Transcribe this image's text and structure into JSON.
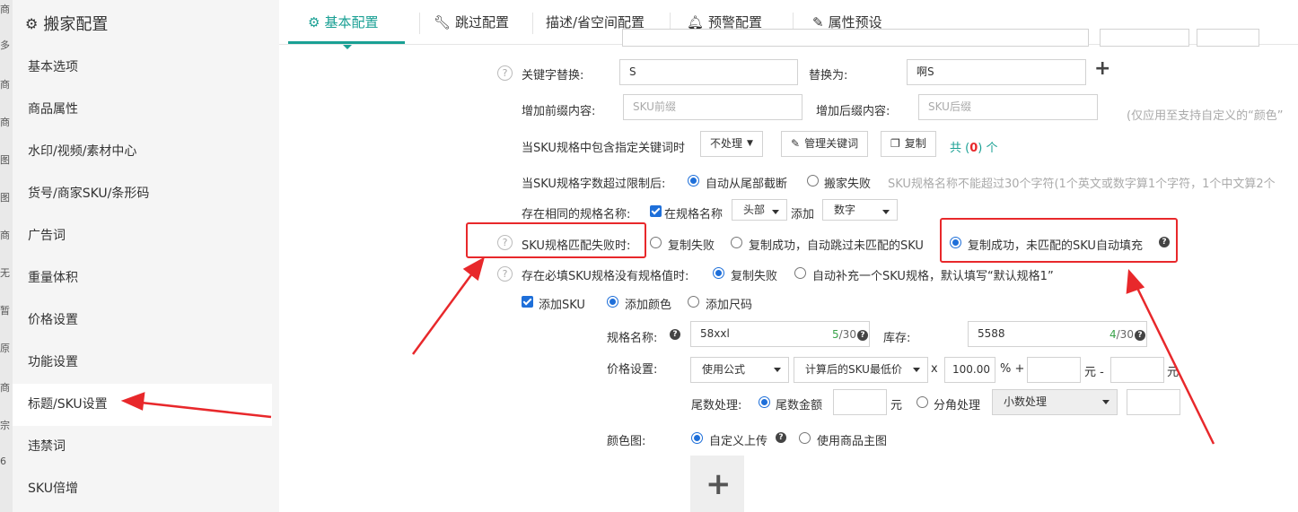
{
  "left_strip": [
    "商",
    "多",
    "商",
    "商",
    "图",
    "图",
    "商",
    "无",
    "暂",
    "原",
    "商",
    "宗",
    "6"
  ],
  "sidebar": {
    "title": "搬家配置",
    "items": [
      {
        "label": "基本选项"
      },
      {
        "label": "商品属性"
      },
      {
        "label": "水印/视频/素材中心"
      },
      {
        "label": "货号/商家SKU/条形码"
      },
      {
        "label": "广告词"
      },
      {
        "label": "重量体积"
      },
      {
        "label": "价格设置"
      },
      {
        "label": "功能设置"
      },
      {
        "label": "标题/SKU设置",
        "active": true
      },
      {
        "label": "违禁词"
      },
      {
        "label": "SKU倍增"
      }
    ]
  },
  "tabs": [
    {
      "label": "基本配置",
      "icon": "gear-icon",
      "active": true
    },
    {
      "label": "跳过配置",
      "icon": "wrench-icon"
    },
    {
      "label": "描述/省空间配置",
      "icon": ""
    },
    {
      "label": "预警配置",
      "icon": "bell-icon"
    },
    {
      "label": "属性预设",
      "icon": "edit-icon"
    }
  ],
  "keyword_replace": {
    "label": "关键字替换:",
    "from_value": "S",
    "to_label": "替换为:",
    "to_value": "啊S",
    "add_symbol": "+"
  },
  "prefix_suffix": {
    "prefix_label": "增加前缀内容:",
    "prefix_placeholder": "SKU前缀",
    "suffix_label": "增加后缀内容:",
    "suffix_placeholder": "SKU后缀",
    "note": "(仅应用至支持自定义的“颜色”"
  },
  "keyword_contains": {
    "label": "当SKU规格中包含指定关键词时",
    "select_value": "不处理",
    "manage_button": "管理关键词",
    "copy_button": "复制",
    "count_prefix": "共",
    "count_open": "(",
    "count": "0",
    "count_close": ")",
    "count_suffix": "个"
  },
  "length_limit": {
    "label": "当SKU规格字数超过限制后:",
    "opt1": "自动从尾部截断",
    "opt2": "搬家失败",
    "note": "SKU规格名称不能超过30个字符(1个英文或数字算1个字符，1个中文算2个"
  },
  "same_name": {
    "label": "存在相同的规格名称:",
    "checkbox_label": "在规格名称",
    "position_value": "头部",
    "add_label": "添加",
    "type_value": "数字"
  },
  "match_fail": {
    "label": "SKU规格匹配失败时:",
    "opt1": "复制失败",
    "opt2": "复制成功，自动跳过未匹配的SKU",
    "opt3": "复制成功，未匹配的SKU自动填充"
  },
  "required_missing": {
    "label": "存在必填SKU规格没有规格值时:",
    "opt1": "复制失败",
    "opt2": "自动补充一个SKU规格，默认填写“默认规格1”"
  },
  "add_sku": {
    "checkbox_label": "添加SKU",
    "opt1": "添加颜色",
    "opt2": "添加尺码",
    "spec_label": "规格名称:",
    "spec_value": "58xxl",
    "spec_count": "5",
    "spec_max": "/30",
    "stock_label": "库存:",
    "stock_value": "5588",
    "stock_count": "4",
    "stock_max": "/30",
    "price_label": "价格设置:",
    "price_mode": "使用公式",
    "price_base": "计算后的SKU最低价",
    "times": "x",
    "ratio": "100.00",
    "percent_plus": "% +",
    "yuan_minus": "元 -",
    "yuan": "元",
    "tail_label": "尾数处理:",
    "tail_opt1": "尾数金额",
    "tail_yuan": "元",
    "tail_opt2": "分角处理",
    "tail_select": "小数处理",
    "color_label": "颜色图:",
    "color_opt1": "自定义上传",
    "color_opt2": "使用商品主图",
    "upload_symbol": "+"
  },
  "colors": {
    "accent": "#1aa094",
    "annotation": "#e8282b",
    "radio": "#1e6fd9"
  }
}
